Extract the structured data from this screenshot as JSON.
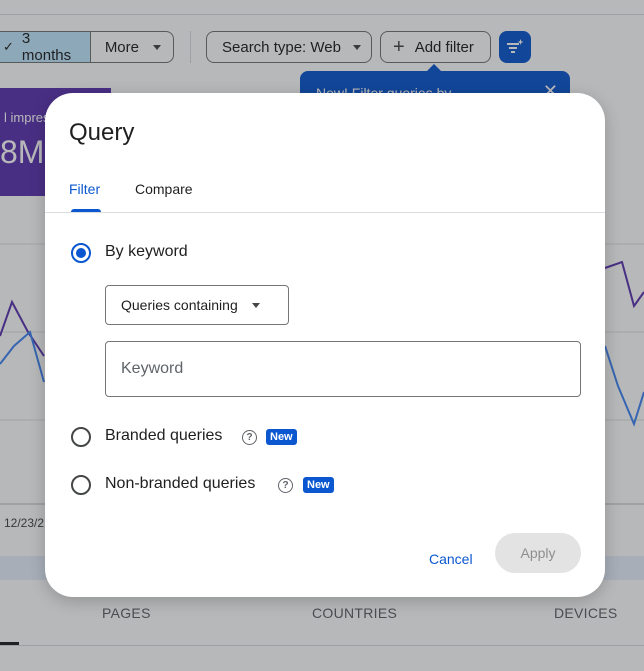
{
  "background": {
    "date_range_chip": "3 months",
    "more_chip": "More",
    "search_type_chip": "Search type: Web",
    "add_filter_chip": "Add filter",
    "tooltip_text": "New! Filter queries by",
    "stat_label": "l impress",
    "stat_value": "8M",
    "axis_date_label": "12/23/2",
    "tabs": [
      "PAGES",
      "COUNTRIES",
      "DEVICES"
    ],
    "colors": {
      "accent": "#0b57d0",
      "stat_card": "#5e35b1",
      "date_chip_selected": "#c2e7ff"
    }
  },
  "dialog": {
    "title": "Query",
    "tabs": {
      "filter": "Filter",
      "compare": "Compare",
      "active": "filter"
    },
    "options": {
      "by_keyword": {
        "label": "By keyword",
        "selected": true
      },
      "branded": {
        "label": "Branded queries",
        "badge": "New",
        "help_icon": "help-circle-icon"
      },
      "non_branded": {
        "label": "Non-branded queries",
        "badge": "New",
        "help_icon": "help-circle-icon"
      }
    },
    "match_select": {
      "value": "Queries containing"
    },
    "keyword_input": {
      "placeholder": "Keyword",
      "value": ""
    },
    "cancel_label": "Cancel",
    "apply_label": "Apply",
    "apply_enabled": false
  }
}
